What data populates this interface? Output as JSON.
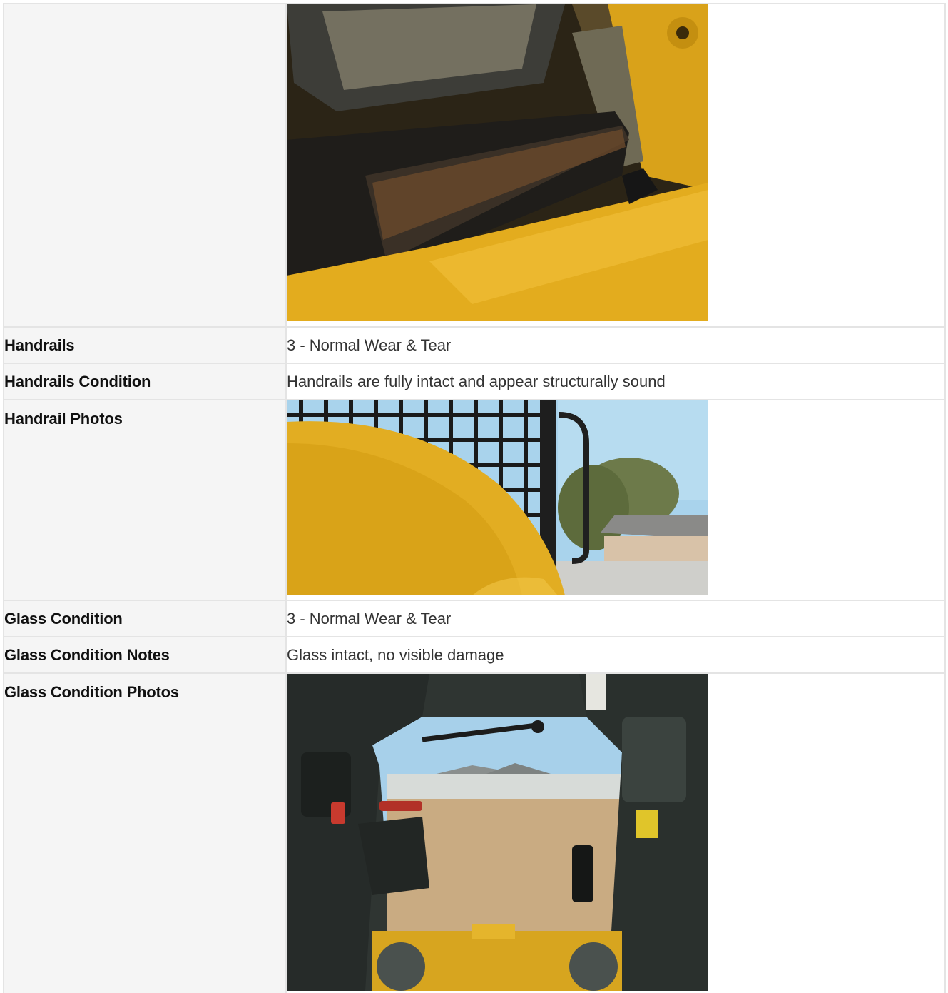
{
  "rows": [
    {
      "label": "",
      "type": "photo",
      "photo": "skid-steer-step-photo"
    },
    {
      "label": "Handrails",
      "type": "text",
      "value": "3 - Normal Wear & Tear"
    },
    {
      "label": "Handrails Condition",
      "type": "text",
      "value": "Handrails are fully intact and appear structurally sound"
    },
    {
      "label": "Handrail Photos",
      "type": "photo",
      "photo": "handrail-cab-cage-photo"
    },
    {
      "label": "Glass Condition",
      "type": "text",
      "value": "3 - Normal Wear & Tear"
    },
    {
      "label": "Glass Condition Notes",
      "type": "text",
      "value": "Glass intact, no visible damage"
    },
    {
      "label": "Glass Condition Photos",
      "type": "photo",
      "photo": "cab-interior-windshield-photo"
    }
  ],
  "colors": {
    "label_bg": "#f5f5f5",
    "border": "#e4e4e4",
    "machine_yellow": "#e0aa1c",
    "sky_blue": "#a9d3ec",
    "dirt": "#c9ab82"
  }
}
